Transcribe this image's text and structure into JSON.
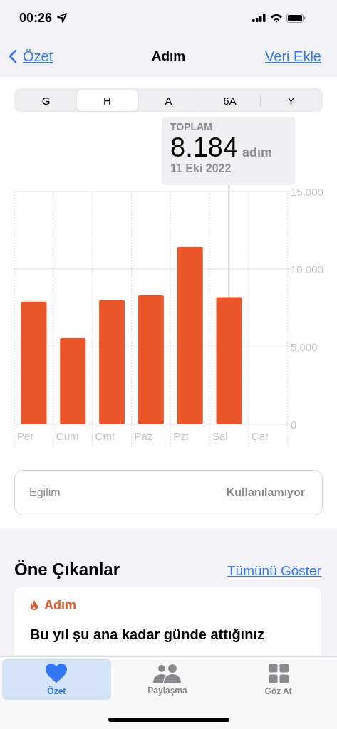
{
  "status_bar": {
    "time": "00:26"
  },
  "nav": {
    "back": "Özet",
    "title": "Adım",
    "action": "Veri Ekle"
  },
  "segments": [
    {
      "label": "G",
      "selected": false
    },
    {
      "label": "H",
      "selected": true
    },
    {
      "label": "A",
      "selected": false
    },
    {
      "label": "6A",
      "selected": false
    },
    {
      "label": "Y",
      "selected": false
    }
  ],
  "selection": {
    "label": "TOPLAM",
    "value": "8.184",
    "unit": "adım",
    "date": "11 Eki 2022"
  },
  "chart_data": {
    "type": "bar",
    "categories": [
      "Per",
      "Cum",
      "Cmt",
      "Paz",
      "Pzt",
      "Sal",
      "Çar"
    ],
    "series": [
      {
        "color": "#e8562a",
        "values": [
          7900,
          5550,
          7980,
          8300,
          11420,
          8184,
          null
        ]
      }
    ],
    "ylim": [
      0,
      15000
    ],
    "yticks": [
      {
        "value": 0,
        "label": "0"
      },
      {
        "value": 5000,
        "label": "5.000"
      },
      {
        "value": 10000,
        "label": "10.000"
      },
      {
        "value": 15000,
        "label": "15.000"
      }
    ]
  },
  "trend": {
    "label": "Eğilim",
    "value": "Kullanılamıyor"
  },
  "highlights": {
    "title": "Öne Çıkanlar",
    "link": "Tümünü Göster",
    "card": {
      "category": "Adım",
      "text": "Bu yıl şu ana kadar günde attığınız"
    }
  },
  "tab_bar": [
    {
      "label": "Özet",
      "kind": "heart",
      "selected": true
    },
    {
      "label": "Paylaşma",
      "kind": "people",
      "selected": false
    },
    {
      "label": "Göz At",
      "kind": "grid",
      "selected": false
    }
  ]
}
